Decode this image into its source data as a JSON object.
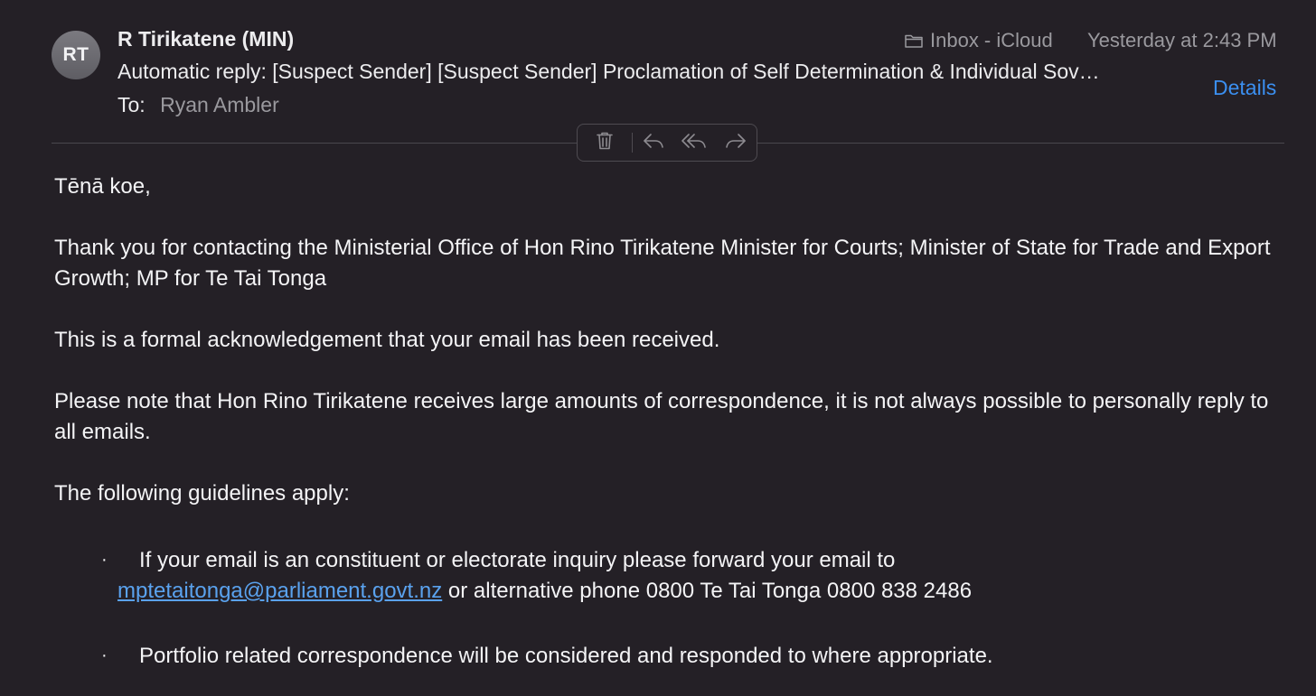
{
  "header": {
    "avatar_initials": "RT",
    "sender": "R Tirikatene (MIN)",
    "subject": "Automatic reply: [Suspect Sender] [Suspect Sender] Proclamation of Self Determination & Individual Sov…",
    "to_label": "To:",
    "to_value": "Ryan Ambler",
    "mailbox": "Inbox - iCloud",
    "date": "Yesterday at 2:43 PM",
    "details_label": "Details"
  },
  "toolbar": {
    "icons": [
      "trash-icon",
      "reply-icon",
      "reply-all-icon",
      "forward-icon"
    ]
  },
  "message": {
    "greeting": "Tēnā koe,",
    "para1": "Thank you for contacting the Ministerial Office of Hon Rino Tirikatene Minister for Courts; Minister of State for Trade and Export Growth; MP for Te Tai Tonga",
    "para2": "This is a formal acknowledgement that your email has been received.",
    "para3": "Please note that Hon Rino Tirikatene receives large amounts of correspondence, it is not always possible to personally reply to all emails.",
    "para4": "The following guidelines apply:",
    "bullet_char": "·",
    "bullet1_text": "If your email is an constituent or electorate inquiry please forward your email to",
    "bullet1_link": "mptetaitonga@parliament.govt.nz",
    "bullet1_after": " or alternative phone 0800 Te Tai Tonga 0800 838 2486",
    "bullet2_text": "Portfolio related correspondence will be considered and responded to where appropriate."
  },
  "colors": {
    "background": "#242026",
    "link": "#5aa2ee",
    "details": "#3b8ff0",
    "muted": "#9a999e"
  }
}
